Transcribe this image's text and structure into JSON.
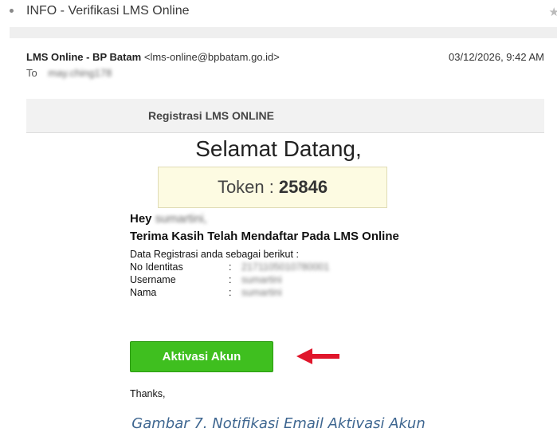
{
  "email": {
    "subject": "INFO - Verifikasi LMS Online",
    "sender_name": "LMS Online - BP Batam",
    "sender_email": "<lms-online@bpbatam.go.id>",
    "date": "03/12/2026, 9:42 AM",
    "to_label": "To",
    "to_value": "may.ching178"
  },
  "content": {
    "header_title": "Registrasi LMS ONLINE",
    "welcome": "Selamat Datang,",
    "token_label": "Token :",
    "token_value": "25846",
    "hey_label": "Hey",
    "hey_name": "sumartini,",
    "thanks_message": "Terima Kasih Telah Mendaftar Pada LMS Online",
    "reg_intro": "Data Registrasi anda sebagai berikut :",
    "fields": [
      {
        "label": "No Identitas",
        "sep": ":",
        "value": "2171105010780001"
      },
      {
        "label": "Username",
        "sep": ":",
        "value": "sumartini"
      },
      {
        "label": "Nama",
        "sep": ":",
        "value": "sumartini"
      }
    ],
    "activate_label": "Aktivasi Akun",
    "closing": "Thanks,"
  },
  "caption": "Gambar 7. Notifikasi Email Aktivasi Akun",
  "colors": {
    "button": "#3fbf1f",
    "arrow": "#e0162b",
    "caption": "#3e6690",
    "token_bg": "#fdfbe2"
  },
  "icons": {
    "star": "star-icon",
    "bullet": "bullet-icon",
    "arrow": "arrow-left-icon"
  }
}
